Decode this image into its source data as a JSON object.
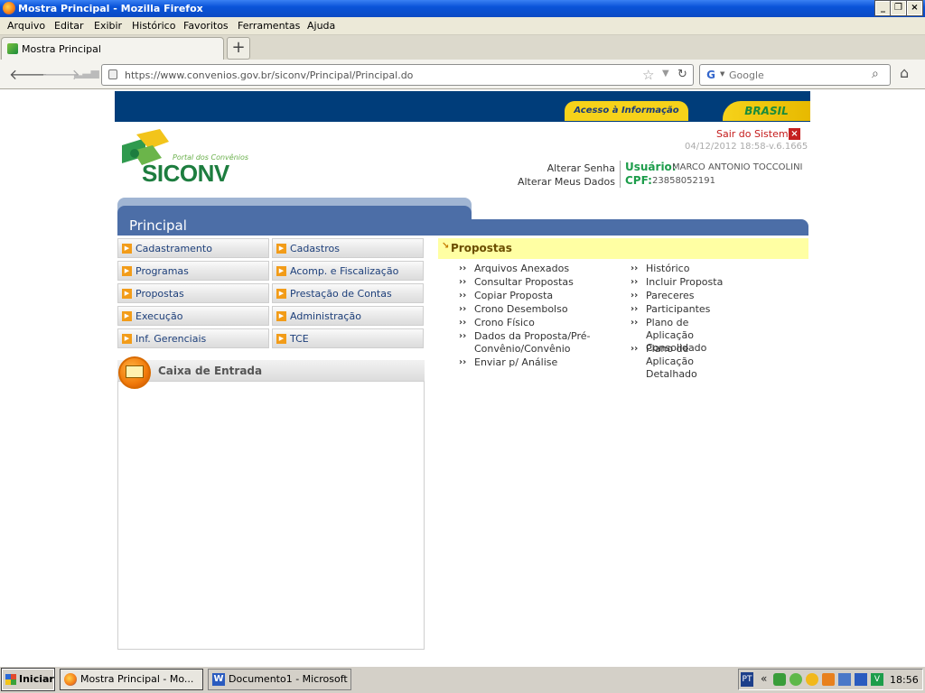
{
  "window": {
    "title": "Mostra Principal - Mozilla Firefox"
  },
  "menubar": [
    "Arquivo",
    "Editar",
    "Exibir",
    "Histórico",
    "Favoritos",
    "Ferramentas",
    "Ajuda"
  ],
  "tab": {
    "label": "Mostra Principal",
    "new_tab_label": "+"
  },
  "nav": {
    "url": "https://www.convenios.gov.br/siconv/Principal/Principal.do",
    "search_placeholder": "Google"
  },
  "header": {
    "acesso": "Acesso à Informação",
    "brasil": "BRASIL",
    "logo_sub": "Portal dos Convênios",
    "logo_name": "SICONV",
    "sair": "Sair do Sistema",
    "version": "04/12/2012 18:58-v.6.1665",
    "alterar_senha": "Alterar Senha",
    "alterar_dados": "Alterar Meus Dados",
    "usuario_label": "Usuário:",
    "usuario_value": "MARCO ANTONIO TOCCOLINI",
    "cpf_label": "CPF:",
    "cpf_value": "23858052191"
  },
  "principal": {
    "title": "Principal"
  },
  "menu": {
    "left": [
      "Cadastramento",
      "Programas",
      "Propostas",
      "Execução",
      "Inf. Gerenciais"
    ],
    "right": [
      "Cadastros",
      "Acomp. e Fiscalização",
      "Prestação de Contas",
      "Administração",
      "TCE"
    ]
  },
  "caixa": {
    "title": "Caixa de Entrada"
  },
  "propostas": {
    "title": "Propostas",
    "col1": [
      "Arquivos Anexados",
      "Consultar Propostas",
      "Copiar Proposta",
      "Crono Desembolso",
      "Crono Físico",
      "Dados da Proposta/Pré-Convênio/Convênio",
      "Enviar p/ Análise"
    ],
    "col2": [
      "Histórico",
      "Incluir Proposta",
      "Pareceres",
      "Participantes",
      "Plano de Aplicação Consolidado",
      "Plano de Aplicação Detalhado"
    ]
  },
  "taskbar": {
    "start": "Iniciar",
    "task1": "Mostra Principal - Mo...",
    "task2": "Documento1 - Microsoft ...",
    "lang": "PT",
    "clock": "18:56"
  },
  "colors": {
    "gov_blue": "#003d7a",
    "siconv_green": "#1d7d3f",
    "principal_blue": "#4c6ea7",
    "propostas_yellow": "#ffffa3"
  }
}
